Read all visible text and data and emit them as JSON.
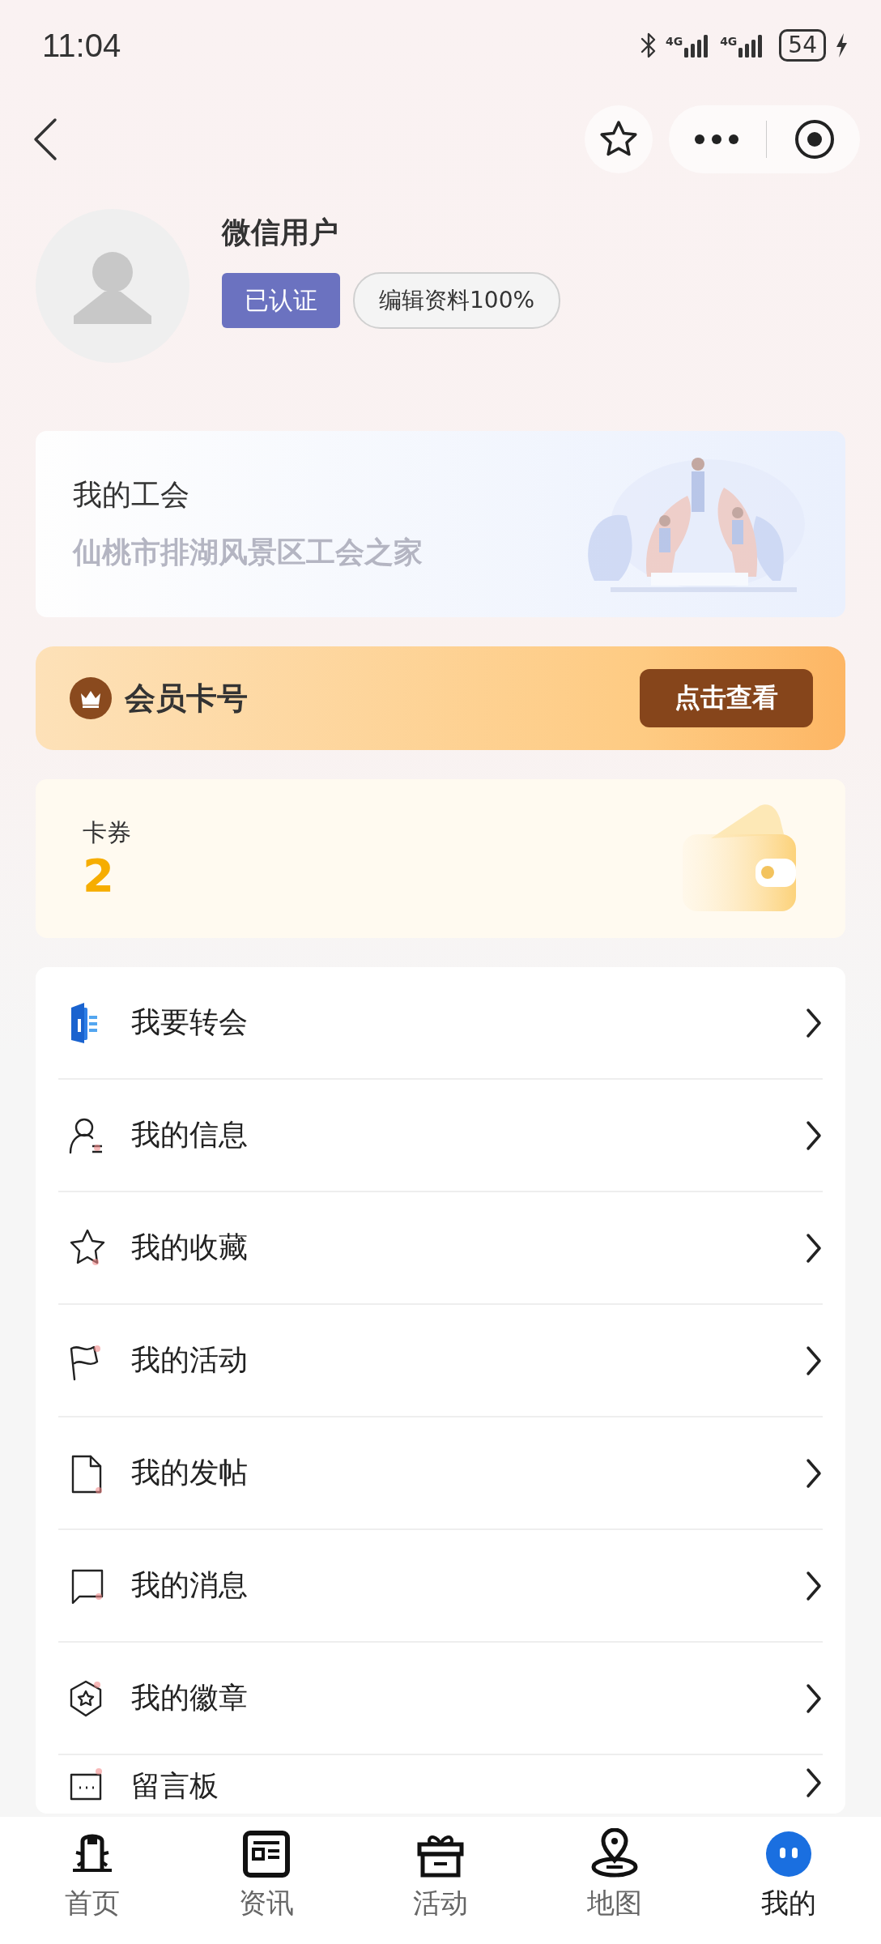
{
  "status_bar": {
    "time": "11:04",
    "network_1": "4G",
    "network_2": "4G",
    "battery": "54"
  },
  "profile": {
    "name": "微信用户",
    "verified": "已认证",
    "edit": "编辑资料100%"
  },
  "union_card": {
    "title": "我的工会",
    "name": "仙桃市排湖风景区工会之家"
  },
  "member_card": {
    "title": "会员卡号",
    "button": "点击查看"
  },
  "coupon_card": {
    "title": "卡券",
    "count": "2"
  },
  "menu": [
    {
      "label": "我要转会"
    },
    {
      "label": "我的信息"
    },
    {
      "label": "我的收藏"
    },
    {
      "label": "我的活动"
    },
    {
      "label": "我的发帖"
    },
    {
      "label": "我的消息"
    },
    {
      "label": "我的徽章"
    },
    {
      "label": "留言板"
    }
  ],
  "tabs": [
    {
      "label": "首页",
      "selected": false
    },
    {
      "label": "资讯",
      "selected": false
    },
    {
      "label": "活动",
      "selected": false
    },
    {
      "label": "地图",
      "selected": false
    },
    {
      "label": "我的",
      "selected": true
    }
  ]
}
